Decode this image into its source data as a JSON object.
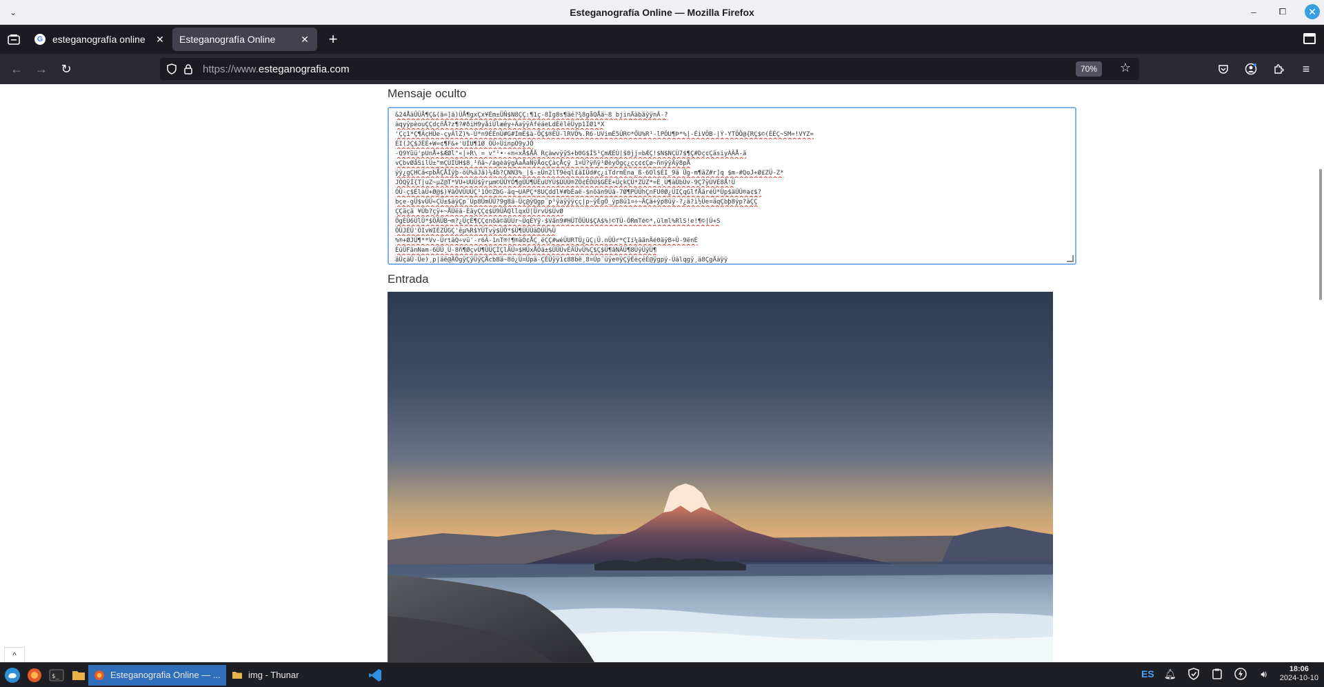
{
  "window": {
    "title": "Esteganografía Online — Mozilla Firefox"
  },
  "tabs": [
    {
      "label": "esteganografía online - Busc",
      "favicon": "google-icon",
      "active": false
    },
    {
      "label": "Esteganografía Online",
      "favicon": "none",
      "active": true
    }
  ],
  "navbar": {
    "url_protocol": "https://www.",
    "url_domain": "esteganografia.com",
    "zoom": "70%"
  },
  "page": {
    "hidden_message_label": "Mensaje oculto",
    "input_label": "Entrada",
    "hidden_message_lines": [
      "&24ÅäÛÜÅ¶Ç&(ä=]ä)ÜÅ¶gxÇx¥Ém±ÜÑ$N8ÇÇ:¶1ç-8Ìg8s¶äé?¾8gåQÅä~8 bjinÄäbäÿÿnÂ-?",
      "àqyÿpèouÇÇdçñÅ?z¶?#ðiH9yåiÜlæéy÷ÄaÿÿÁféáeLdÉëlëÜyp1ÍØ1*X",
      "'Çç1*Ç¶ÂçHÜe-çyÂlZ)%-Ú*n9ÉÉnÙ#G#ImÉ$à-ÕÇ$®ÉÙ-lRVÖ%.R6-UVimÉ5ÜR©*ÔU%R¹-lPÖU¶Þ*%|-ÉiVÖB-|Ý-YTÖÔ@{RÇ$©(ÉÉÇ~SM=!VYZ=",
      "ÉI(JÇ$JÉÉ+W=¢¶F&+'UÍU¶1Ø ÖÜ÷ÜinpÒ9yJÖ",
      "-Q9Yüü'pUnÅ+$ÆØl°«|»R\\ =   v°¹•·«n«xÅ$ÅÄ  RçàwvÿÿS+b0G$ÍS¹ÇmÆÉÙ|$0jj=bÆÇ!$N$NÇÙ7$¶Ç#Dç¢ÇäsiyÀÂÅ-ä",
      "vÇbvØåSilÜ±°mÇÙIÜH$8¸¹ñâ~/àgèàÿgÃaÅaÑÿÅoçÇàçÅçÿ 1¤Ü?ÿñÿ¹ØèyÖgç¿çç¢¢Çø~ñnÿÿÄÿ8pÅ",
      "ÿÿ¿gÇHCä<pbÅÇÅÌÿþ-öÙ%äJä)¼4b?ÇNN3%_|$-±Ün2lT9èql£äIÜd#ç¿iTdrmÈna_ß-6Ol$ÈI_9ä Üg-m¶ãZ#r]q $m-#QoJ+Ø£ZÜ-Z*",
      "JÖQÿÍ{T|uZ~µZ@T*VU+UUÜ$ÿrµm©ÜÜYÖ¶gÜÜ¶ÜÉuUYÜ$ÙÙÜ®ZÖ¢ÉÖÜ$GËÈ+ÜçkÇÜ*ZÙZ*=È¸Ù¶àÜbÜv-9Ç7ÿÙVÉ8Å!Ü",
      "ÓÛ-ç$ÉlàÜ+Ø@$)¥äÖVÛUÜÇ¹1Ö©ZbG-äq¬UAPÇ*8UÇddl¥#bÉaë-$nöän9Üä-7Ø¶PÜÜhÇnFU0Ø¿ÜIÇqGlfÅäréÜ*Üp$äÜÜ®a¢$?",
      "bçe-gÜ$vÜÜ«ÇÜ±$äÿÇp¨Üp8ÜmÜÜ?9g8ä-Üç@ÿQgp¨p¹ÿàÿÿÿçç|p~ÿÉgÖ_ÿp8ü1¤÷~ÄÇä+ÿp8üÿ-?¿ä?ì½Üe¤äqÇbþ8ÿp?äÇÇ",
      "ÇÇäçä ¥Üb?çÿ+~ÅÜëä-ÈäyÇÇ¢$Ü9ÜÄQllqxÜ|ÜrvÜ$ÜvØ",
      "ÕgÉÜ6ÜlÜ*$ÕÄÜB¬m?¿ÜçÈ¶ÇÇ¢nöä©äÜUr~ÜqÈYÿ-$Vän9#HÜTÖÜU$ÇA$%!©TÜ-ÖRmTé©*,ülml%RlS!e!¶©|Ü+S",
      "ÕÜJÉÜ'ÖIvWIÉZÜGÇ'ëµ%R$YÜTvÿ$ÜÕ*$Ü¶ÜÜÜäDÜÜ%Ü",
      "%®+ØJÜ¶**Vv-ÜrtäQ÷vü'-r6Â-1nT®!¶®äÖ¢ÅÇ¸ëÇÇ#wéÜURTÜ¿üÇ¡Ü.nÜÜr*ÇIi¼äänÄé0äÿB÷Ü-9ënÉ",
      "ÈüÜFänNam-6ÜÜ¸Ü-8ñ¶ØçvÙ¶ÜÜÇÍÇlÄÜ¤$HÜxÅÖä±$ÜÜÜvÉÄÜvÜ%Ç$Ç$Ü¶äNÄÜ¶8ÜÿÜÿÜ¶",
      "äÜçäÜ-Üe)¸p|äë@ÄÖgÿÇÿÜÿÇÅcb8ä~8ö¿Ü¤Üpä-ÇÉÜÿÿ1¢88bë¸8¤Üp¨üÿe®ÿÇÿÉèçéÉ@ÿgpÿ-Üälqgÿ¸ä8ÇgÄàÿÿ"
    ]
  },
  "taskbar": {
    "items": [
      {
        "label": "Esteganografia Online — ...",
        "active": true,
        "icon": "firefox-icon"
      },
      {
        "label": "img - Thunar",
        "active": false,
        "icon": "folder-icon"
      }
    ],
    "language": "ES",
    "time": "18:06",
    "date": "2024-10-10"
  },
  "colors": {
    "accent": "#2f6fba",
    "textarea_border": "#7ab2f0",
    "tab_active": "#42414d",
    "toolbar_bg": "#2b2a33"
  }
}
